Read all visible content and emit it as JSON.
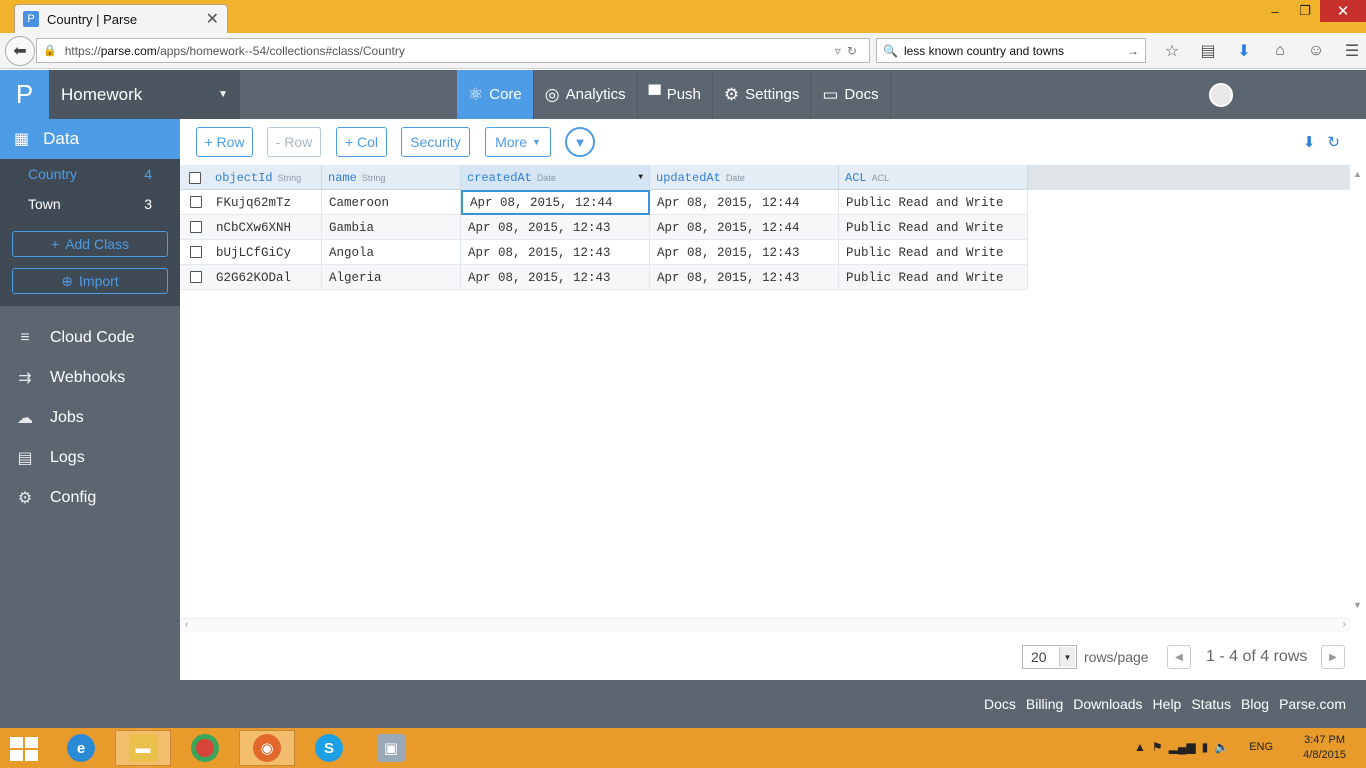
{
  "browser": {
    "tab_title": "Country | Parse",
    "tab_favicon": "P",
    "url_prefix": "https://",
    "url_host": "parse.com",
    "url_path": "/apps/homework--54/collections#class/Country",
    "search_value": "less known country and towns"
  },
  "app": {
    "logo": "P",
    "name": "Homework",
    "nav": [
      {
        "label": "Core",
        "icon": "atom-icon"
      },
      {
        "label": "Analytics",
        "icon": "pulse-icon"
      },
      {
        "label": "Push",
        "icon": "chat-icon"
      },
      {
        "label": "Settings",
        "icon": "gear-icon"
      },
      {
        "label": "Docs",
        "icon": "book-icon"
      }
    ]
  },
  "sidebar": {
    "data_label": "Data",
    "classes": [
      {
        "name": "Country",
        "count": "4"
      },
      {
        "name": "Town",
        "count": "3"
      }
    ],
    "add_class": "Add Class",
    "import": "Import",
    "menu": [
      {
        "label": "Cloud Code",
        "icon": "code-icon"
      },
      {
        "label": "Webhooks",
        "icon": "webhook-icon"
      },
      {
        "label": "Jobs",
        "icon": "cloud-icon"
      },
      {
        "label": "Logs",
        "icon": "logs-icon"
      },
      {
        "label": "Config",
        "icon": "config-icon"
      }
    ]
  },
  "toolbar": {
    "add_row": "+ Row",
    "remove_row": "- Row",
    "add_col": "+ Col",
    "security": "Security",
    "more": "More"
  },
  "grid": {
    "columns": [
      {
        "name": "objectId",
        "type": "String"
      },
      {
        "name": "name",
        "type": "String"
      },
      {
        "name": "createdAt",
        "type": "Date"
      },
      {
        "name": "updatedAt",
        "type": "Date"
      },
      {
        "name": "ACL",
        "type": "ACL"
      }
    ],
    "rows": [
      [
        "FKujq62mTz",
        "Cameroon",
        "Apr 08, 2015, 12:44",
        "Apr 08, 2015, 12:44",
        "Public Read and Write"
      ],
      [
        "nCbCXw6XNH",
        "Gambia",
        "Apr 08, 2015, 12:43",
        "Apr 08, 2015, 12:44",
        "Public Read and Write"
      ],
      [
        "bUjLCfGiCy",
        "Angola",
        "Apr 08, 2015, 12:43",
        "Apr 08, 2015, 12:43",
        "Public Read and Write"
      ],
      [
        "G2G62KODal",
        "Algeria",
        "Apr 08, 2015, 12:43",
        "Apr 08, 2015, 12:43",
        "Public Read and Write"
      ]
    ]
  },
  "pager": {
    "per_page": "20",
    "per_page_label": "rows/page",
    "range": "1 - 4 of 4 rows"
  },
  "footer": {
    "links": [
      "Docs",
      "Billing",
      "Downloads",
      "Help",
      "Status",
      "Blog",
      "Parse.com"
    ]
  },
  "taskbar": {
    "lang": "ENG",
    "time": "3:47 PM",
    "date": "4/8/2015"
  },
  "colors": {
    "accent": "#4d9ce5",
    "header_bg": "#5b6670",
    "taskbar": "#e89b2a"
  }
}
